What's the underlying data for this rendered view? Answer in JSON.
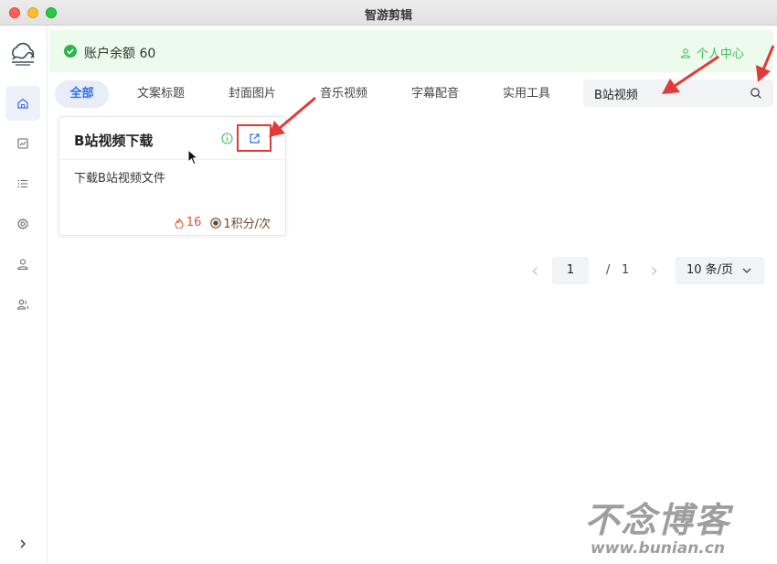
{
  "window": {
    "title": "智游剪辑"
  },
  "sidebar": {
    "items": [
      {
        "name": "home-icon",
        "active": true
      },
      {
        "name": "chart-icon",
        "active": false
      },
      {
        "name": "list-icon",
        "active": false
      },
      {
        "name": "gear-icon",
        "active": false
      },
      {
        "name": "user-icon",
        "active": false
      },
      {
        "name": "users-icon",
        "active": false
      }
    ],
    "expand_icon": "chevron-right-icon"
  },
  "balance": {
    "text": "账户余额 60",
    "user_center_label": "个人中心"
  },
  "tabs": [
    {
      "label": "全部",
      "active": true
    },
    {
      "label": "文案标题",
      "active": false
    },
    {
      "label": "封面图片",
      "active": false
    },
    {
      "label": "音乐视频",
      "active": false
    },
    {
      "label": "字幕配音",
      "active": false
    },
    {
      "label": "实用工具",
      "active": false
    }
  ],
  "search": {
    "value": "B站视频"
  },
  "tool_card": {
    "title": "B站视频下载",
    "description": "下载B站视频文件",
    "hot_count": "16",
    "cost": "1积分/次"
  },
  "pagination": {
    "current_page": "1",
    "separator": "/",
    "total_pages": "1",
    "page_size": "10 条/页"
  },
  "watermark": {
    "logo_text": "不念博客",
    "url": "www.bunian.cn"
  },
  "colors": {
    "accent": "#2f6cf6",
    "success": "#3fbf57",
    "annotation": "#e23a3a"
  }
}
